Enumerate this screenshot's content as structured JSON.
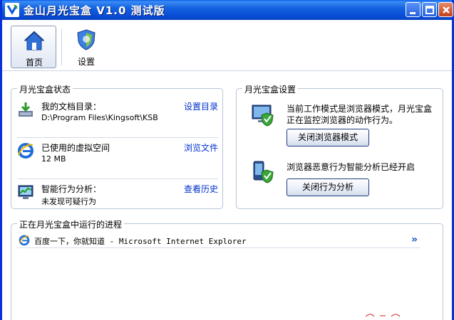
{
  "window": {
    "title": "金山月光宝盒 V1.0 测试版",
    "min_icon": "minimize-icon",
    "max_icon": "maximize-icon",
    "close_icon": "close-icon",
    "title_bar_color": "#0a56dc"
  },
  "toolbar": {
    "home_label": "首页",
    "settings_label": "设置"
  },
  "status_panel": {
    "title": "月光宝盒状态",
    "rows": [
      {
        "icon": "documents-download-icon",
        "label": "我的文档目录：",
        "value": "D:\\Program Files\\Kingsoft\\KSB",
        "link": "设置目录"
      },
      {
        "icon": "ie-icon",
        "label": "已使用的虚拟空间",
        "value": "12 MB",
        "link": "浏览文件"
      },
      {
        "icon": "monitor-chart-icon",
        "label": "智能行为分析：",
        "value": "未发现可疑行为",
        "link": "查看历史"
      }
    ]
  },
  "settings_panel": {
    "title": "月光宝盒设置",
    "mode_text": "当前工作模式是浏览器模式，月光宝盒正在监控浏览器的动作行为。",
    "mode_button": "关闭浏览器模式",
    "analysis_text": "浏览器恶意行为智能分析已经开启",
    "analysis_button": "关闭行为分析"
  },
  "process_panel": {
    "title": "正在月光宝盒中运行的进程",
    "items": [
      {
        "icon": "ie-icon",
        "text": "百度一下，你就知道 - Microsoft Internet Explorer",
        "more": "»"
      }
    ]
  },
  "colors": {
    "accent": "#0831d9",
    "link": "#0033cc",
    "panel_border": "#b8c6d8"
  }
}
